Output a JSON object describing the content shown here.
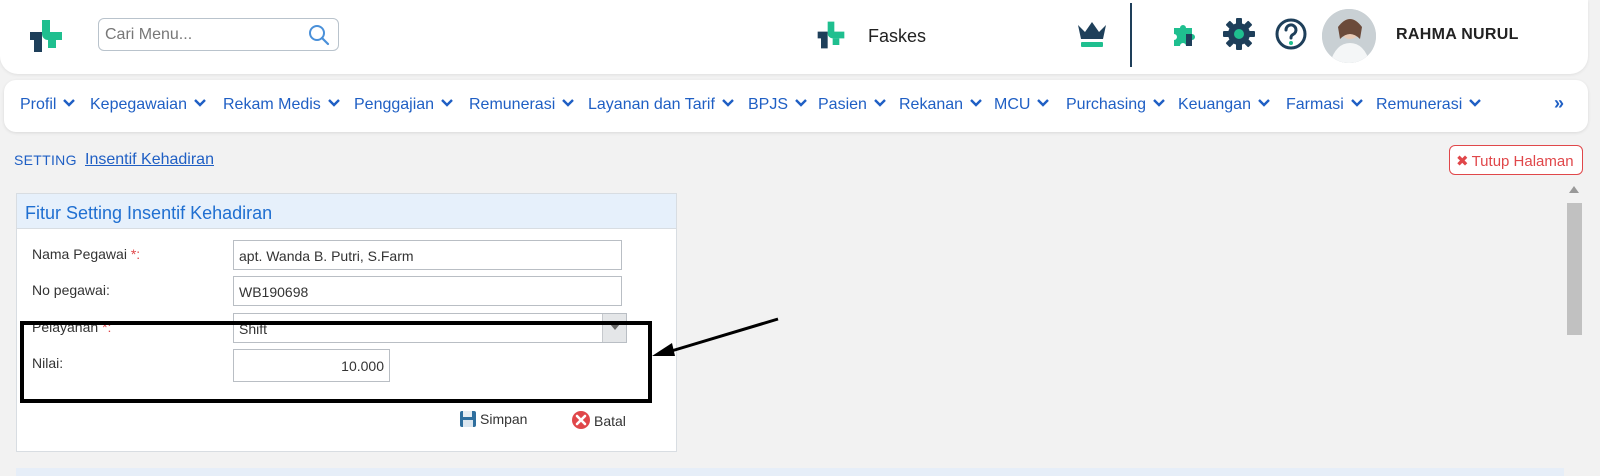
{
  "header": {
    "search_placeholder": "Cari Menu...",
    "facility": "Faskes",
    "user_name": "RAHMA NURUL",
    "brand_colors": {
      "teal": "#1fbf8f",
      "navy": "#1e3f5a"
    }
  },
  "nav": {
    "items": [
      "Profil",
      "Kepegawaian",
      "Rekam Medis",
      "Penggajian",
      "Remunerasi",
      "Layanan dan Tarif",
      "BPJS",
      "Pasien",
      "Rekanan",
      "MCU",
      "Purchasing",
      "Keuangan",
      "Farmasi",
      "Remunerasi"
    ],
    "more": "»"
  },
  "breadcrumb": {
    "section": "SETTING",
    "current": "Insentif Kehadiran"
  },
  "close_page": {
    "label": "Tutup Halaman"
  },
  "form": {
    "title": "Fitur Setting Insentif Kehadiran",
    "fields": {
      "nama_label": "Nama Pegawai",
      "nama_value": "apt. Wanda B. Putri, S.Farm",
      "no_label": "No pegawai:",
      "no_value": "WB190698",
      "pelayanan_label": "Pelayanan",
      "pelayanan_value": "Shift",
      "nilai_label": "Nilai:",
      "nilai_value": "10.000"
    },
    "required_mark": "*:",
    "save_label": "Simpan",
    "cancel_label": "Batal"
  }
}
